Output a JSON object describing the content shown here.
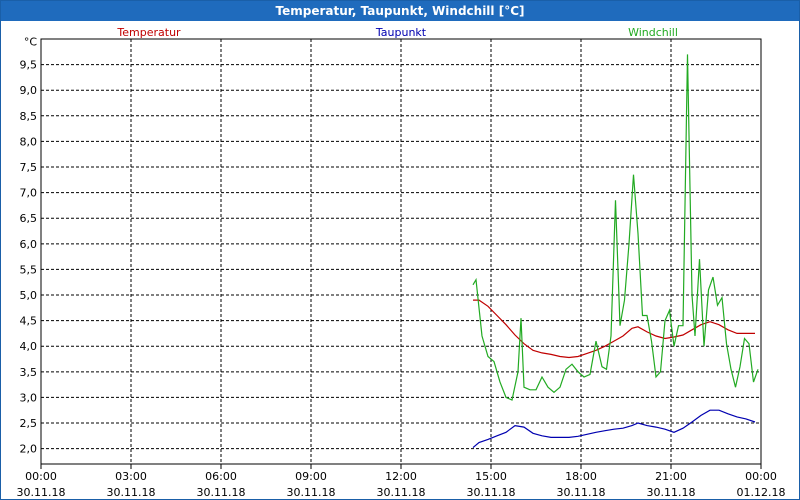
{
  "window": {
    "title": "Temperatur, Taupunkt, Windchill [°C]"
  },
  "chart_data": {
    "type": "line",
    "title": "Temperatur, Taupunkt, Windchill [°C]",
    "ylabel": "°C",
    "ylim": [
      1.7,
      10.0
    ],
    "yticks": [
      "2,0",
      "2,5",
      "3,0",
      "3,5",
      "4,0",
      "4,5",
      "5,0",
      "5,5",
      "6,0",
      "6,5",
      "7,0",
      "7,5",
      "8,0",
      "8,5",
      "9,0",
      "9,5"
    ],
    "ytick_values": [
      2.0,
      2.5,
      3.0,
      3.5,
      4.0,
      4.5,
      5.0,
      5.5,
      6.0,
      6.5,
      7.0,
      7.5,
      8.0,
      8.5,
      9.0,
      9.5
    ],
    "xlim": [
      0,
      24
    ],
    "xticks": [
      {
        "time": "00:00",
        "date": "30.11.18",
        "h": 0
      },
      {
        "time": "03:00",
        "date": "30.11.18",
        "h": 3
      },
      {
        "time": "06:00",
        "date": "30.11.18",
        "h": 6
      },
      {
        "time": "09:00",
        "date": "30.11.18",
        "h": 9
      },
      {
        "time": "12:00",
        "date": "30.11.18",
        "h": 12
      },
      {
        "time": "15:00",
        "date": "30.11.18",
        "h": 15
      },
      {
        "time": "18:00",
        "date": "30.11.18",
        "h": 18
      },
      {
        "time": "21:00",
        "date": "30.11.18",
        "h": 21
      },
      {
        "time": "00:00",
        "date": "01.12.18",
        "h": 24
      }
    ],
    "grid": true,
    "legend_placement": "top",
    "series": [
      {
        "name": "Temperatur",
        "color": "#c00000",
        "points": [
          [
            14.4,
            4.9
          ],
          [
            14.6,
            4.9
          ],
          [
            14.9,
            4.78
          ],
          [
            15.2,
            4.6
          ],
          [
            15.5,
            4.42
          ],
          [
            15.8,
            4.22
          ],
          [
            16.1,
            4.05
          ],
          [
            16.4,
            3.92
          ],
          [
            16.7,
            3.87
          ],
          [
            17.0,
            3.84
          ],
          [
            17.3,
            3.8
          ],
          [
            17.6,
            3.78
          ],
          [
            17.9,
            3.8
          ],
          [
            18.2,
            3.86
          ],
          [
            18.5,
            3.92
          ],
          [
            18.8,
            4.0
          ],
          [
            19.1,
            4.1
          ],
          [
            19.4,
            4.2
          ],
          [
            19.7,
            4.35
          ],
          [
            19.9,
            4.38
          ],
          [
            20.2,
            4.28
          ],
          [
            20.5,
            4.2
          ],
          [
            20.8,
            4.15
          ],
          [
            21.1,
            4.18
          ],
          [
            21.4,
            4.22
          ],
          [
            21.7,
            4.32
          ],
          [
            22.0,
            4.42
          ],
          [
            22.3,
            4.48
          ],
          [
            22.6,
            4.42
          ],
          [
            22.9,
            4.32
          ],
          [
            23.2,
            4.25
          ],
          [
            23.5,
            4.25
          ],
          [
            23.8,
            4.25
          ]
        ]
      },
      {
        "name": "Taupunkt",
        "color": "#0000b0",
        "points": [
          [
            14.4,
            2.02
          ],
          [
            14.6,
            2.12
          ],
          [
            14.9,
            2.18
          ],
          [
            15.2,
            2.25
          ],
          [
            15.5,
            2.32
          ],
          [
            15.8,
            2.45
          ],
          [
            16.1,
            2.42
          ],
          [
            16.4,
            2.3
          ],
          [
            16.7,
            2.25
          ],
          [
            17.0,
            2.22
          ],
          [
            17.3,
            2.22
          ],
          [
            17.6,
            2.22
          ],
          [
            17.9,
            2.24
          ],
          [
            18.2,
            2.28
          ],
          [
            18.5,
            2.32
          ],
          [
            18.8,
            2.35
          ],
          [
            19.1,
            2.38
          ],
          [
            19.4,
            2.4
          ],
          [
            19.7,
            2.45
          ],
          [
            19.9,
            2.5
          ],
          [
            20.2,
            2.45
          ],
          [
            20.5,
            2.42
          ],
          [
            20.8,
            2.38
          ],
          [
            21.1,
            2.32
          ],
          [
            21.4,
            2.4
          ],
          [
            21.7,
            2.52
          ],
          [
            22.0,
            2.65
          ],
          [
            22.3,
            2.75
          ],
          [
            22.6,
            2.75
          ],
          [
            22.9,
            2.68
          ],
          [
            23.2,
            2.62
          ],
          [
            23.5,
            2.58
          ],
          [
            23.8,
            2.52
          ]
        ]
      },
      {
        "name": "Windchill",
        "color": "#22aa22",
        "points": [
          [
            14.4,
            5.2
          ],
          [
            14.5,
            5.3
          ],
          [
            14.7,
            4.2
          ],
          [
            14.9,
            3.8
          ],
          [
            15.1,
            3.7
          ],
          [
            15.3,
            3.3
          ],
          [
            15.5,
            3.0
          ],
          [
            15.7,
            2.95
          ],
          [
            15.9,
            3.5
          ],
          [
            16.0,
            4.55
          ],
          [
            16.1,
            3.2
          ],
          [
            16.3,
            3.15
          ],
          [
            16.5,
            3.15
          ],
          [
            16.7,
            3.4
          ],
          [
            16.9,
            3.2
          ],
          [
            17.1,
            3.1
          ],
          [
            17.3,
            3.2
          ],
          [
            17.5,
            3.55
          ],
          [
            17.7,
            3.65
          ],
          [
            17.9,
            3.5
          ],
          [
            18.1,
            3.4
          ],
          [
            18.3,
            3.45
          ],
          [
            18.5,
            4.1
          ],
          [
            18.7,
            3.6
          ],
          [
            18.85,
            3.55
          ],
          [
            19.0,
            4.2
          ],
          [
            19.15,
            6.85
          ],
          [
            19.3,
            4.4
          ],
          [
            19.45,
            4.9
          ],
          [
            19.6,
            6.0
          ],
          [
            19.75,
            7.35
          ],
          [
            19.9,
            6.2
          ],
          [
            20.05,
            4.6
          ],
          [
            20.2,
            4.6
          ],
          [
            20.35,
            4.1
          ],
          [
            20.5,
            3.4
          ],
          [
            20.65,
            3.5
          ],
          [
            20.8,
            4.5
          ],
          [
            20.95,
            4.7
          ],
          [
            21.1,
            4.0
          ],
          [
            21.25,
            4.4
          ],
          [
            21.4,
            4.4
          ],
          [
            21.55,
            9.7
          ],
          [
            21.7,
            5.0
          ],
          [
            21.8,
            4.2
          ],
          [
            21.95,
            5.7
          ],
          [
            22.1,
            4.0
          ],
          [
            22.25,
            5.1
          ],
          [
            22.4,
            5.35
          ],
          [
            22.55,
            4.8
          ],
          [
            22.7,
            4.95
          ],
          [
            22.85,
            4.05
          ],
          [
            23.0,
            3.55
          ],
          [
            23.15,
            3.2
          ],
          [
            23.3,
            3.6
          ],
          [
            23.45,
            4.15
          ],
          [
            23.6,
            4.05
          ],
          [
            23.75,
            3.3
          ],
          [
            23.9,
            3.55
          ]
        ]
      }
    ]
  }
}
